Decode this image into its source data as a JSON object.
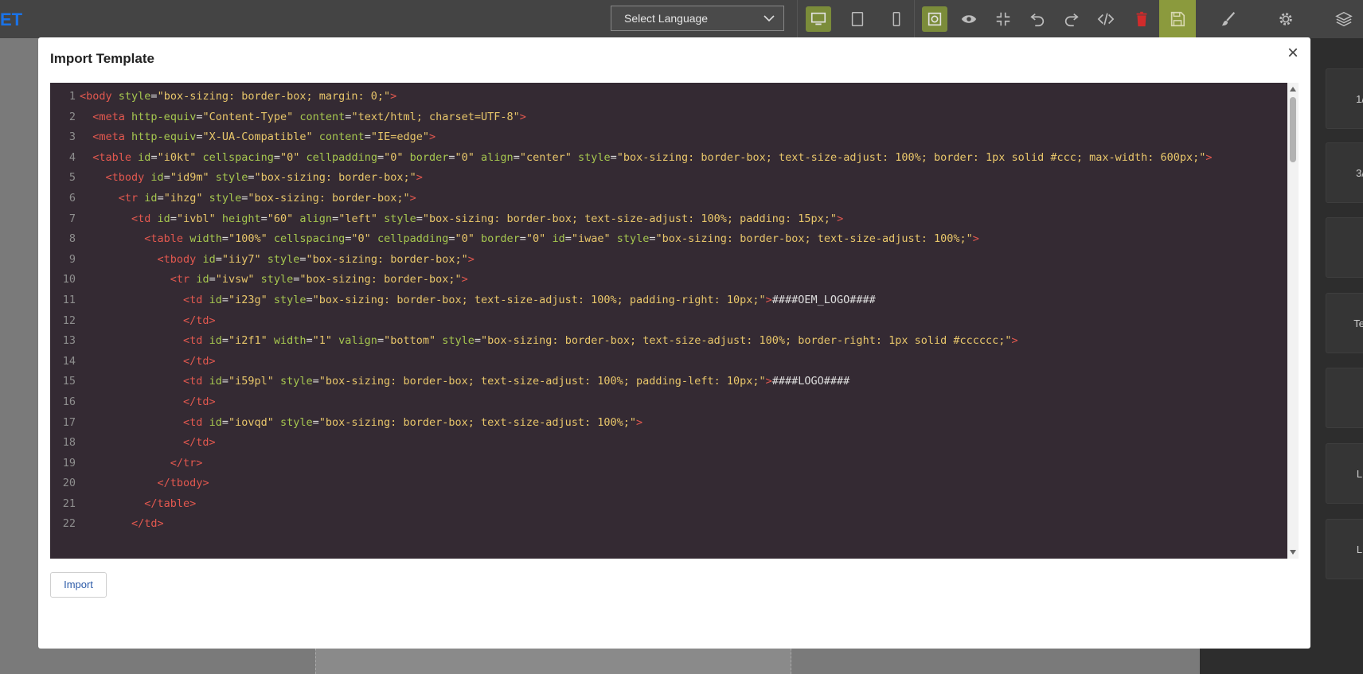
{
  "app": {
    "brand_text": "ET",
    "language_select": {
      "value": "Select Language"
    },
    "toolbar_icons": [
      "desktop-icon",
      "tablet-icon",
      "mobile-icon",
      "outline-icon",
      "eye-icon",
      "fullscreen-exit-icon",
      "undo-icon",
      "redo-icon",
      "code-icon",
      "trash-icon",
      "save-icon",
      "brush-icon",
      "gear-icon",
      "layers-icon"
    ],
    "right_panel_cards": [
      "1/",
      "3/",
      "",
      "Te",
      "",
      "Li",
      "Li"
    ]
  },
  "modal": {
    "title": "Import Template",
    "close_label": "×",
    "import_label": "Import",
    "code_lines": [
      {
        "n": "1",
        "indent": "",
        "tokens": [
          [
            "t",
            "<body "
          ],
          [
            "a",
            "style"
          ],
          [
            "p",
            "="
          ],
          [
            "v",
            "\"box-sizing: border-box; margin: 0;\""
          ],
          [
            "t",
            ">"
          ]
        ]
      },
      {
        "n": "2",
        "indent": "  ",
        "tokens": [
          [
            "t",
            "<meta "
          ],
          [
            "a",
            "http-equiv"
          ],
          [
            "p",
            "="
          ],
          [
            "v",
            "\"Content-Type\" "
          ],
          [
            "a",
            "content"
          ],
          [
            "p",
            "="
          ],
          [
            "v",
            "\"text/html; charset=UTF-8\""
          ],
          [
            "t",
            ">"
          ]
        ]
      },
      {
        "n": "3",
        "indent": "  ",
        "tokens": [
          [
            "t",
            "<meta "
          ],
          [
            "a",
            "http-equiv"
          ],
          [
            "p",
            "="
          ],
          [
            "v",
            "\"X-UA-Compatible\" "
          ],
          [
            "a",
            "content"
          ],
          [
            "p",
            "="
          ],
          [
            "v",
            "\"IE=edge\""
          ],
          [
            "t",
            ">"
          ]
        ]
      },
      {
        "n": "4",
        "indent": "  ",
        "wrap": true,
        "tokens": [
          [
            "t",
            "<table "
          ],
          [
            "a",
            "id"
          ],
          [
            "p",
            "="
          ],
          [
            "v",
            "\"i0kt\" "
          ],
          [
            "a",
            "cellspacing"
          ],
          [
            "p",
            "="
          ],
          [
            "v",
            "\"0\" "
          ],
          [
            "a",
            "cellpadding"
          ],
          [
            "p",
            "="
          ],
          [
            "v",
            "\"0\" "
          ],
          [
            "a",
            "border"
          ],
          [
            "p",
            "="
          ],
          [
            "v",
            "\"0\" "
          ],
          [
            "a",
            "align"
          ],
          [
            "p",
            "="
          ],
          [
            "v",
            "\"center\" "
          ],
          [
            "a",
            "style"
          ],
          [
            "p",
            "="
          ],
          [
            "v",
            "\"box-sizing: border-box; text-size-adjust: 100%; border: 1px solid #ccc; max-width: 600px;\""
          ],
          [
            "t",
            ">"
          ]
        ]
      },
      {
        "n": "5",
        "indent": "    ",
        "tokens": [
          [
            "t",
            "<tbody "
          ],
          [
            "a",
            "id"
          ],
          [
            "p",
            "="
          ],
          [
            "v",
            "\"id9m\" "
          ],
          [
            "a",
            "style"
          ],
          [
            "p",
            "="
          ],
          [
            "v",
            "\"box-sizing: border-box;\""
          ],
          [
            "t",
            ">"
          ]
        ]
      },
      {
        "n": "6",
        "indent": "      ",
        "tokens": [
          [
            "t",
            "<tr "
          ],
          [
            "a",
            "id"
          ],
          [
            "p",
            "="
          ],
          [
            "v",
            "\"ihzg\" "
          ],
          [
            "a",
            "style"
          ],
          [
            "p",
            "="
          ],
          [
            "v",
            "\"box-sizing: border-box;\""
          ],
          [
            "t",
            ">"
          ]
        ]
      },
      {
        "n": "7",
        "indent": "        ",
        "tokens": [
          [
            "t",
            "<td "
          ],
          [
            "a",
            "id"
          ],
          [
            "p",
            "="
          ],
          [
            "v",
            "\"ivbl\" "
          ],
          [
            "a",
            "height"
          ],
          [
            "p",
            "="
          ],
          [
            "v",
            "\"60\" "
          ],
          [
            "a",
            "align"
          ],
          [
            "p",
            "="
          ],
          [
            "v",
            "\"left\" "
          ],
          [
            "a",
            "style"
          ],
          [
            "p",
            "="
          ],
          [
            "v",
            "\"box-sizing: border-box; text-size-adjust: 100%; padding: 15px;\""
          ],
          [
            "t",
            ">"
          ]
        ]
      },
      {
        "n": "8",
        "indent": "          ",
        "tokens": [
          [
            "t",
            "<table "
          ],
          [
            "a",
            "width"
          ],
          [
            "p",
            "="
          ],
          [
            "v",
            "\"100%\" "
          ],
          [
            "a",
            "cellspacing"
          ],
          [
            "p",
            "="
          ],
          [
            "v",
            "\"0\" "
          ],
          [
            "a",
            "cellpadding"
          ],
          [
            "p",
            "="
          ],
          [
            "v",
            "\"0\" "
          ],
          [
            "a",
            "border"
          ],
          [
            "p",
            "="
          ],
          [
            "v",
            "\"0\" "
          ],
          [
            "a",
            "id"
          ],
          [
            "p",
            "="
          ],
          [
            "v",
            "\"iwae\" "
          ],
          [
            "a",
            "style"
          ],
          [
            "p",
            "="
          ],
          [
            "v",
            "\"box-sizing: border-box; text-size-adjust: 100%;\""
          ],
          [
            "t",
            ">"
          ]
        ]
      },
      {
        "n": "9",
        "indent": "            ",
        "tokens": [
          [
            "t",
            "<tbody "
          ],
          [
            "a",
            "id"
          ],
          [
            "p",
            "="
          ],
          [
            "v",
            "\"iiy7\" "
          ],
          [
            "a",
            "style"
          ],
          [
            "p",
            "="
          ],
          [
            "v",
            "\"box-sizing: border-box;\""
          ],
          [
            "t",
            ">"
          ]
        ]
      },
      {
        "n": "10",
        "indent": "              ",
        "tokens": [
          [
            "t",
            "<tr "
          ],
          [
            "a",
            "id"
          ],
          [
            "p",
            "="
          ],
          [
            "v",
            "\"ivsw\" "
          ],
          [
            "a",
            "style"
          ],
          [
            "p",
            "="
          ],
          [
            "v",
            "\"box-sizing: border-box;\""
          ],
          [
            "t",
            ">"
          ]
        ]
      },
      {
        "n": "11",
        "indent": "                ",
        "tokens": [
          [
            "t",
            "<td "
          ],
          [
            "a",
            "id"
          ],
          [
            "p",
            "="
          ],
          [
            "v",
            "\"i23g\" "
          ],
          [
            "a",
            "style"
          ],
          [
            "p",
            "="
          ],
          [
            "v",
            "\"box-sizing: border-box; text-size-adjust: 100%; padding-right: 10px;\""
          ],
          [
            "t",
            ">"
          ],
          [
            "p",
            "####OEM_LOGO####"
          ]
        ]
      },
      {
        "n": "12",
        "indent": "                ",
        "tokens": [
          [
            "t",
            "</td>"
          ]
        ]
      },
      {
        "n": "13",
        "indent": "                ",
        "tokens": [
          [
            "t",
            "<td "
          ],
          [
            "a",
            "id"
          ],
          [
            "p",
            "="
          ],
          [
            "v",
            "\"i2f1\" "
          ],
          [
            "a",
            "width"
          ],
          [
            "p",
            "="
          ],
          [
            "v",
            "\"1\" "
          ],
          [
            "a",
            "valign"
          ],
          [
            "p",
            "="
          ],
          [
            "v",
            "\"bottom\" "
          ],
          [
            "a",
            "style"
          ],
          [
            "p",
            "="
          ],
          [
            "v",
            "\"box-sizing: border-box; text-size-adjust: 100%; border-right: 1px solid #cccccc;\""
          ],
          [
            "t",
            ">"
          ]
        ]
      },
      {
        "n": "14",
        "indent": "                ",
        "tokens": [
          [
            "t",
            "</td>"
          ]
        ]
      },
      {
        "n": "15",
        "indent": "                ",
        "tokens": [
          [
            "t",
            "<td "
          ],
          [
            "a",
            "id"
          ],
          [
            "p",
            "="
          ],
          [
            "v",
            "\"i59pl\" "
          ],
          [
            "a",
            "style"
          ],
          [
            "p",
            "="
          ],
          [
            "v",
            "\"box-sizing: border-box; text-size-adjust: 100%; padding-left: 10px;\""
          ],
          [
            "t",
            ">"
          ],
          [
            "p",
            "####LOGO####"
          ]
        ]
      },
      {
        "n": "16",
        "indent": "                ",
        "tokens": [
          [
            "t",
            "</td>"
          ]
        ]
      },
      {
        "n": "17",
        "indent": "                ",
        "tokens": [
          [
            "t",
            "<td "
          ],
          [
            "a",
            "id"
          ],
          [
            "p",
            "="
          ],
          [
            "v",
            "\"iovqd\" "
          ],
          [
            "a",
            "style"
          ],
          [
            "p",
            "="
          ],
          [
            "v",
            "\"box-sizing: border-box; text-size-adjust: 100%;\""
          ],
          [
            "t",
            ">"
          ]
        ]
      },
      {
        "n": "18",
        "indent": "                ",
        "tokens": [
          [
            "t",
            "</td>"
          ]
        ]
      },
      {
        "n": "19",
        "indent": "              ",
        "tokens": [
          [
            "t",
            "</tr>"
          ]
        ]
      },
      {
        "n": "20",
        "indent": "            ",
        "tokens": [
          [
            "t",
            "</tbody>"
          ]
        ]
      },
      {
        "n": "21",
        "indent": "          ",
        "tokens": [
          [
            "t",
            "</table>"
          ]
        ]
      },
      {
        "n": "22",
        "indent": "        ",
        "tokens": [
          [
            "t",
            "</td>"
          ]
        ]
      }
    ]
  },
  "colors": {
    "editor_bg": "#342a33",
    "tag": "#e2584f",
    "attr": "#a6c74f",
    "value": "#e8c66a",
    "toolbar_active": "#7b8c3a",
    "delete": "#d12b2b"
  }
}
